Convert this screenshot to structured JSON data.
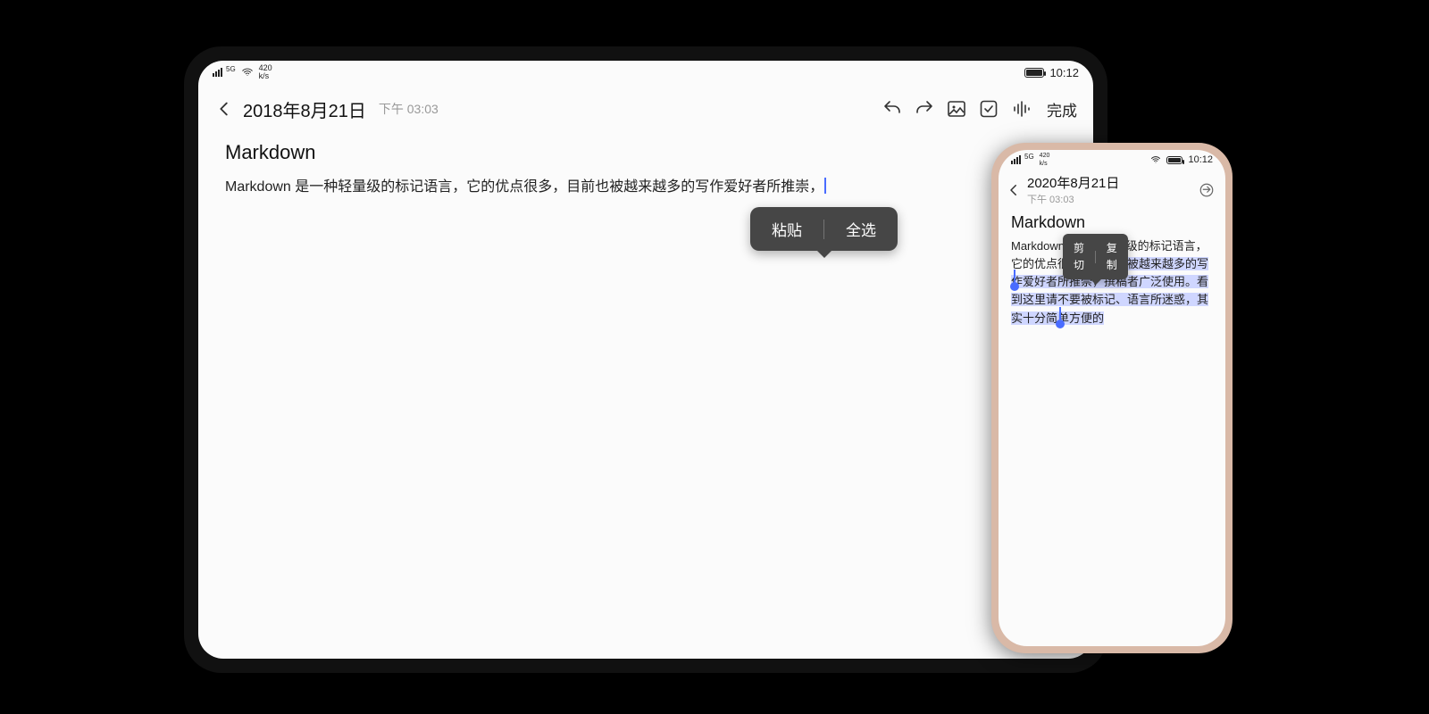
{
  "tablet": {
    "status": {
      "signal_label": "5G",
      "net_speed_top": "420",
      "net_speed_bottom": "k/s",
      "clock": "10:12"
    },
    "header": {
      "date": "2018年8月21日",
      "time": "下午 03:03",
      "done_label": "完成"
    },
    "note": {
      "title": "Markdown",
      "body": "Markdown 是一种轻量级的标记语言，它的优点很多，目前也被越来越多的写作爱好者所推崇，"
    },
    "context_menu": {
      "paste": "粘贴",
      "select_all": "全选"
    }
  },
  "phone": {
    "status": {
      "signal_label": "5G",
      "net_speed_top": "420",
      "net_speed_bottom": "k/s",
      "clock": "10:12"
    },
    "header": {
      "date": "2020年8月21日",
      "time": "下午 03:03"
    },
    "note": {
      "title": "Markdown",
      "body_pre": "Markdown ",
      "body_mid_unselected": "是一种轻量级的标记语言，它的优点很多，目前也",
      "body_sel": "被越来越多的写作爱好者所推崇，撰稿者广泛使用。看到这里请不要被标记、语言所迷惑，其实十分简单方便的"
    },
    "context_menu": {
      "cut": "剪切",
      "copy": "复制"
    }
  }
}
